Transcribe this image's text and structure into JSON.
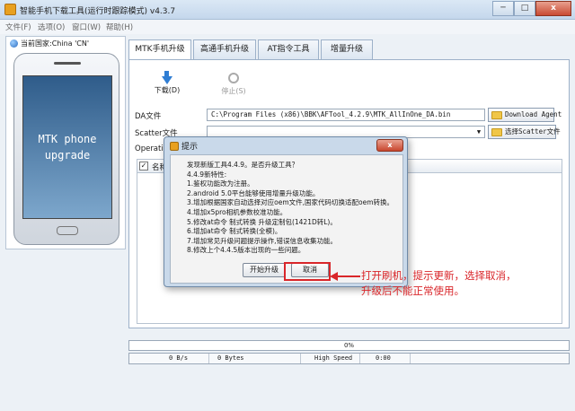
{
  "window": {
    "title": "智能手机下载工具(运行时跟踪模式)  v4.3.7",
    "minimize": "─",
    "maximize": "□",
    "close": "x"
  },
  "menu": [
    "文件(F)",
    "选项(O)",
    "窗口(W)",
    "帮助(H)"
  ],
  "left_panel": {
    "region": "当前国家:China 'CN'",
    "phone_lines": [
      "MTK phone",
      "upgrade"
    ]
  },
  "tabs": [
    "MTK手机升级",
    "高通手机升级",
    "AT指令工具",
    "增量升级"
  ],
  "toolbar": {
    "download": "下载(D)",
    "stop": "停止(S)"
  },
  "form": {
    "da_label": "DA文件",
    "da_value": "C:\\Program Files (x86)\\BBK\\AFTool_4.2.9\\MTK_AllInOne_DA.bin",
    "da_button": "Download Agent",
    "scatter_label": "Scatter文件",
    "scatter_value": "",
    "scatter_button": "选择Scatter文件",
    "operation_label": "Operatio"
  },
  "grid": {
    "header_check": "✓",
    "col_name": "名称"
  },
  "progress": {
    "percent_text": "0%",
    "fraction": 0
  },
  "status": {
    "speed": "0 B/s",
    "bytes": "0 Bytes",
    "mode": "High Speed",
    "time": "0:00"
  },
  "dialog": {
    "title": "提示",
    "close": "x",
    "lines": [
      "发现新版工具4.4.9。是否升级工具？",
      "4.4.9新特性:",
      "1.鉴权功能改为注册。",
      "2.android 5.0平台能够使用增量升级功能。",
      "3.增加根据国家自动选择对应oem文件,国家代码切换适配oem转换。",
      "4.增加x5pro相机参数校准功能。",
      "5.修改at命令 制式转换 升级定制包(1421D转L)。",
      "6.增加at命令 制式转换(全模)。",
      "7.增加常见升级问题提示操作,错误信息收集功能。",
      "8.修改上个4.4.5版本出现的一些问题。"
    ],
    "ok": "开始升级",
    "cancel": "取消"
  },
  "annotation": {
    "lines": [
      "打开刷机，提示更新，选择取消，",
      "升级后不能正常使用。"
    ],
    "color": "#d9262a"
  }
}
